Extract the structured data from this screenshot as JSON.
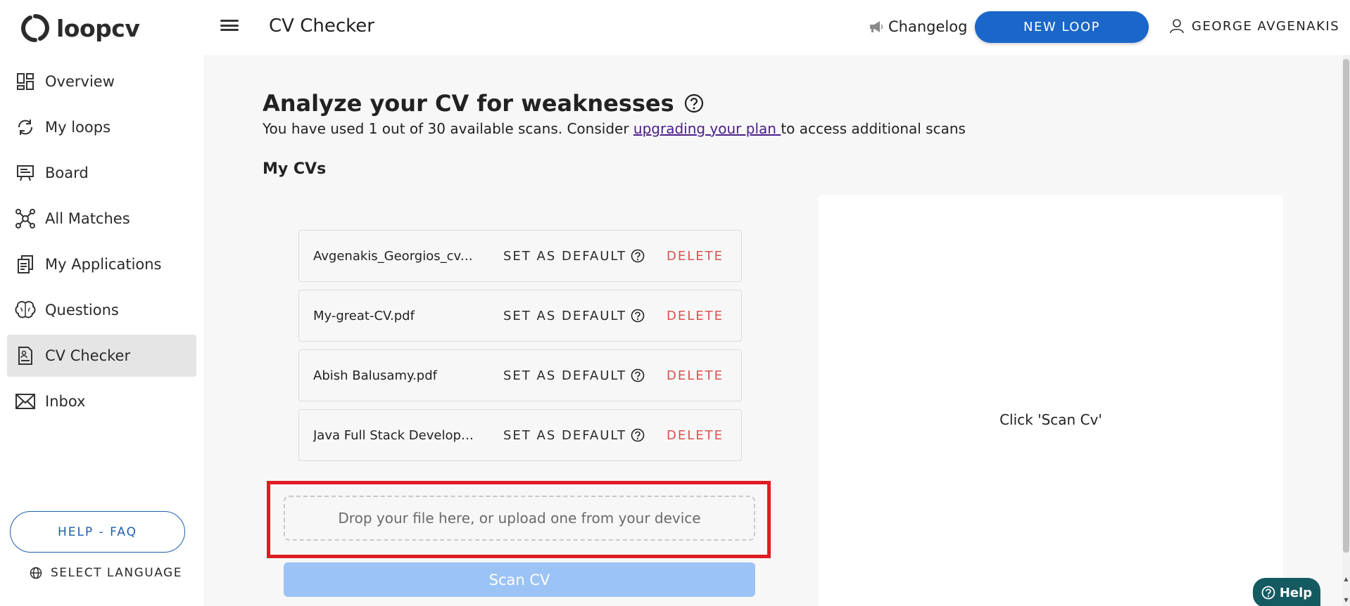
{
  "brand": {
    "name": "loopcv"
  },
  "header": {
    "title": "CV Checker",
    "changelog_label": "Changelog",
    "new_loop_label": "NEW LOOP",
    "user_name": "GEORGE AVGENAKIS"
  },
  "sidebar": {
    "items": [
      {
        "label": "Overview",
        "icon": "dashboard-icon"
      },
      {
        "label": "My loops",
        "icon": "refresh-icon"
      },
      {
        "label": "Board",
        "icon": "board-icon"
      },
      {
        "label": "All Matches",
        "icon": "network-icon"
      },
      {
        "label": "My Applications",
        "icon": "documents-icon"
      },
      {
        "label": "Questions",
        "icon": "brain-icon"
      },
      {
        "label": "CV Checker",
        "icon": "cv-document-icon",
        "active": true
      },
      {
        "label": "Inbox",
        "icon": "mail-icon"
      }
    ],
    "help_faq_label": "HELP - FAQ",
    "language_label": "SELECT LANGUAGE"
  },
  "main": {
    "heading": "Analyze your CV for weaknesses",
    "subtitle_prefix": "You have used 1 out of 30 available scans. Consider ",
    "subtitle_link": "upgrading your plan ",
    "subtitle_suffix": "to access additional scans",
    "section_title": "My CVs",
    "cvs": [
      {
        "name": "Avgenakis_Georgios_cv.pdf"
      },
      {
        "name": "My-great-CV.pdf"
      },
      {
        "name": "Abish Balusamy.pdf"
      },
      {
        "name": "Java Full Stack Developer Resume.pdf"
      }
    ],
    "set_default_label": "SET AS DEFAULT",
    "delete_label": "DELETE",
    "dropzone_text": "Drop your file here, or upload one from your device",
    "scan_button_label": "Scan CV",
    "result_placeholder": "Click 'Scan Cv'"
  },
  "help_widget": {
    "label": "Help"
  },
  "colors": {
    "primary": "#1a66c9",
    "delete": "#d9534f",
    "highlight": "#e01b22",
    "scan_disabled": "#9cc3f5",
    "help_widget": "#145a61"
  }
}
